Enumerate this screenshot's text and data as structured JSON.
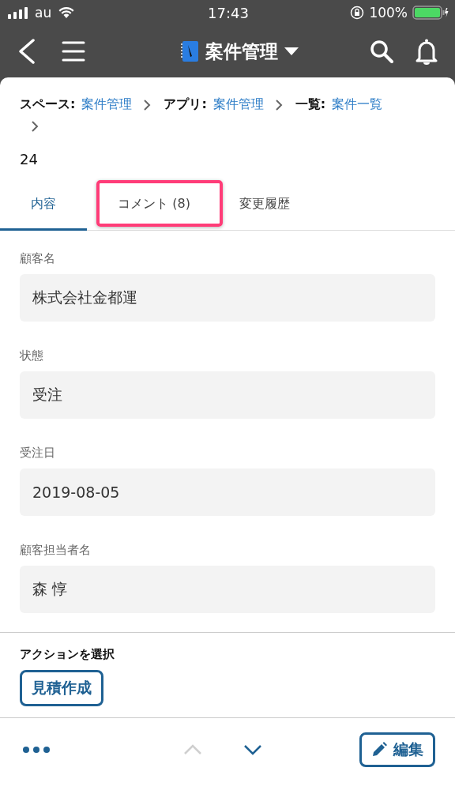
{
  "status_bar": {
    "carrier": "au",
    "time": "17:43",
    "battery": "100%"
  },
  "nav": {
    "title": "案件管理"
  },
  "breadcrumb": [
    {
      "label": "スペース:",
      "link": "案件管理"
    },
    {
      "label": "アプリ:",
      "link": "案件管理"
    },
    {
      "label": "一覧:",
      "link": "案件一覧"
    }
  ],
  "record_id": "24",
  "tabs": [
    {
      "label": "内容",
      "selected": true,
      "highlighted": false
    },
    {
      "label": "コメント (8)",
      "selected": false,
      "highlighted": true
    },
    {
      "label": "変更履歴",
      "selected": false,
      "highlighted": false
    }
  ],
  "fields": [
    {
      "label": "顧客名",
      "value": "株式会社金都運"
    },
    {
      "label": "状態",
      "value": "受注"
    },
    {
      "label": "受注日",
      "value": "2019-08-05"
    },
    {
      "label": "顧客担当者名",
      "value": "森 惇"
    }
  ],
  "actions": {
    "title": "アクションを選択",
    "buttons": [
      "見積作成"
    ]
  },
  "footer": {
    "prev_disabled": true,
    "next_disabled": false,
    "edit": "編集"
  }
}
